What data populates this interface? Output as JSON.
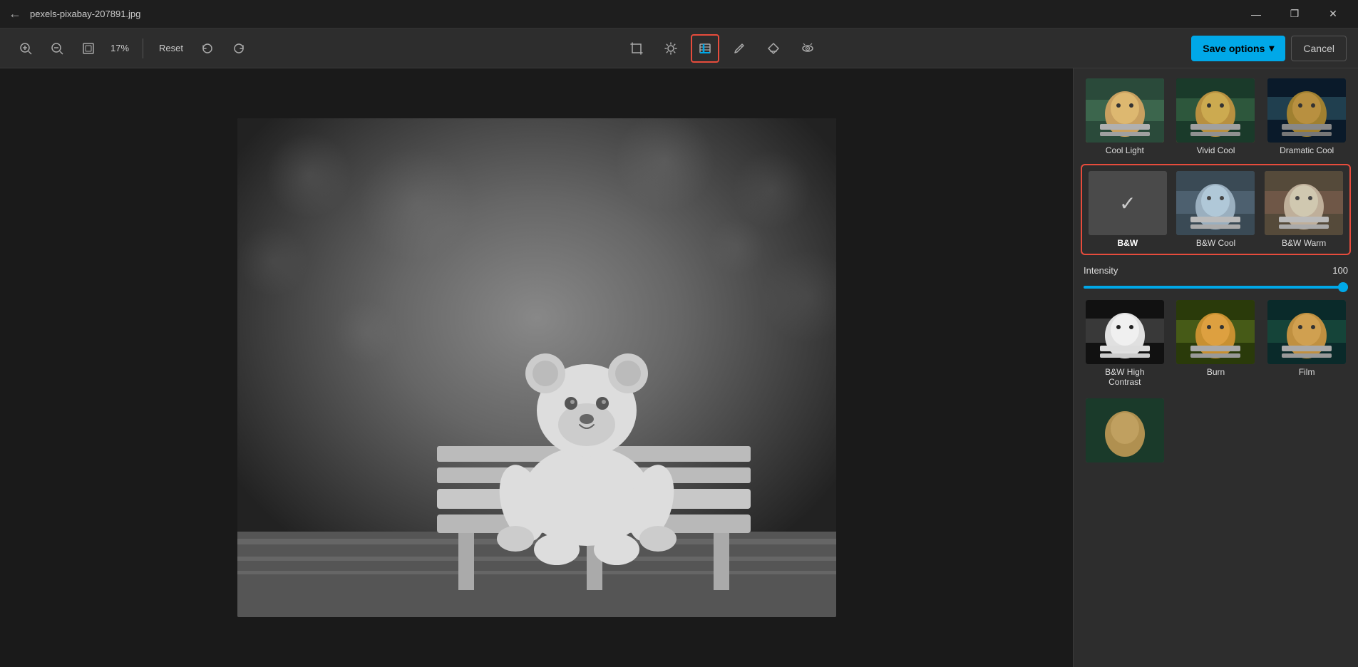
{
  "titlebar": {
    "title": "pexels-pixabay-207891.jpg",
    "back_label": "←",
    "minimize_label": "—",
    "maximize_label": "❐",
    "close_label": "✕"
  },
  "toolbar": {
    "zoom_in_label": "+",
    "zoom_out_label": "−",
    "fit_label": "⊡",
    "zoom_value": "17%",
    "reset_label": "Reset",
    "undo_label": "↺",
    "redo_label": "↻",
    "crop_label": "⤡",
    "brightness_label": "☀",
    "filters_label": "🖌",
    "markup_label": "✏",
    "erase_label": "◈",
    "redeye_label": "⁘",
    "save_options_label": "Save options",
    "save_options_arrow": "▾",
    "cancel_label": "Cancel"
  },
  "filters_panel": {
    "row1": [
      {
        "id": "cool-light",
        "label": "Cool Light",
        "thumb_class": "filter-thumb-cool-light"
      },
      {
        "id": "vivid-cool",
        "label": "Vivid Cool",
        "thumb_class": "filter-thumb-vivid-cool"
      },
      {
        "id": "dramatic-cool",
        "label": "Dramatic Cool",
        "thumb_class": "filter-thumb-dramatic-cool"
      }
    ],
    "selected_row": [
      {
        "id": "bw",
        "label": "B&W",
        "is_checkmark": true
      },
      {
        "id": "bw-cool",
        "label": "B&W Cool",
        "thumb_class": "filter-thumb-bw-cool"
      },
      {
        "id": "bw-warm",
        "label": "B&W Warm",
        "thumb_class": "filter-thumb-bw-warm"
      }
    ],
    "intensity_label": "Intensity",
    "intensity_value": "100",
    "row3": [
      {
        "id": "bw-high-contrast",
        "label": "B&W High Contrast",
        "thumb_class": "filter-thumb-bw-high"
      },
      {
        "id": "burn",
        "label": "Burn",
        "thumb_class": "filter-thumb-burn"
      },
      {
        "id": "film",
        "label": "Film",
        "thumb_class": "filter-thumb-film"
      }
    ]
  }
}
